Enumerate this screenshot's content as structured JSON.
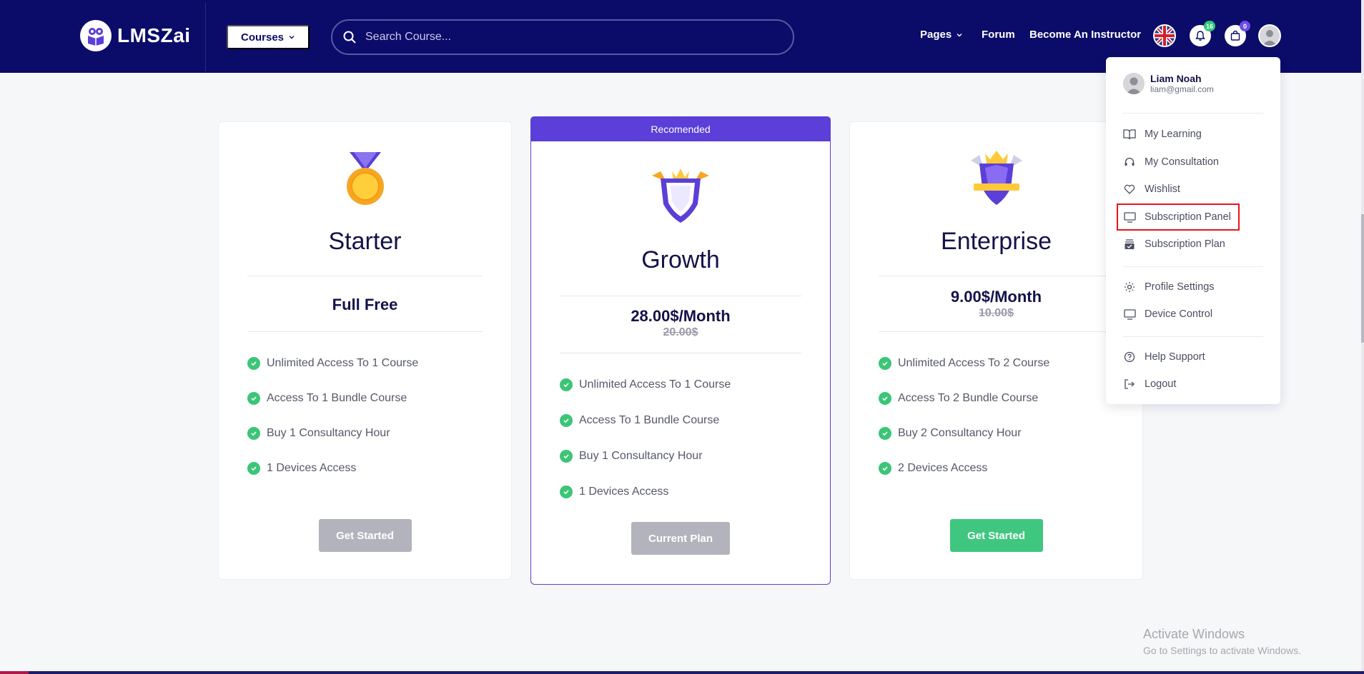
{
  "header": {
    "logo_text": "LMSZai",
    "courses_label": "Courses",
    "search_placeholder": "Search Course...",
    "nav": {
      "pages": "Pages",
      "forum": "Forum",
      "instructor": "Become An Instructor"
    },
    "notification_count": "16",
    "cart_count": "0"
  },
  "plans": [
    {
      "name": "Starter",
      "price": "Full Free",
      "old_price": "",
      "features": [
        "Unlimited Access To 1 Course",
        "Access To 1 Bundle Course",
        "Buy 1 Consultancy Hour",
        "1 Devices Access"
      ],
      "button": "Get Started"
    },
    {
      "ribbon": "Recomended",
      "name": "Growth",
      "price": "28.00$/Month",
      "old_price": "20.00$",
      "features": [
        "Unlimited Access To 1 Course",
        "Access To 1 Bundle Course",
        "Buy 1 Consultancy Hour",
        "1 Devices Access"
      ],
      "button": "Current Plan"
    },
    {
      "name": "Enterprise",
      "price": "9.00$/Month",
      "old_price": "10.00$",
      "features": [
        "Unlimited Access To 2 Course",
        "Access To 2 Bundle Course",
        "Buy 2 Consultancy Hour",
        "2 Devices Access"
      ],
      "button": "Get Started"
    }
  ],
  "dropdown": {
    "user_name": "Liam Noah",
    "user_email": "liam@gmail.com",
    "items": [
      {
        "label": "My Learning",
        "icon": "book-icon"
      },
      {
        "label": "My Consultation",
        "icon": "headset-icon"
      },
      {
        "label": "Wishlist",
        "icon": "heart-icon"
      },
      {
        "label": "Subscription Panel",
        "icon": "monitor-icon"
      },
      {
        "label": "Subscription Plan",
        "icon": "stack-icon"
      },
      {
        "label": "Profile Settings",
        "icon": "gear-icon"
      },
      {
        "label": "Device Control",
        "icon": "monitor-icon"
      },
      {
        "label": "Help Support",
        "icon": "help-circle-icon"
      },
      {
        "label": "Logout",
        "icon": "logout-icon"
      }
    ]
  },
  "watermark": {
    "title": "Activate Windows",
    "subtitle": "Go to Settings to activate Windows."
  },
  "colors": {
    "header_bg": "#0b0b6a",
    "accent_purple": "#5b3fd8",
    "success_green": "#3fc77f",
    "highlight_red": "#e8141c"
  }
}
